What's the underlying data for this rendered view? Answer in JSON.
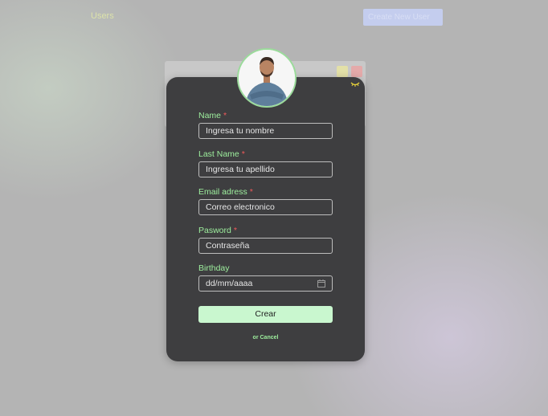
{
  "topbar": {
    "users_label": "Users",
    "create_label": "Create New User"
  },
  "form": {
    "required_mark": "*",
    "fields": [
      {
        "label": "Name",
        "required": true,
        "placeholder": "Ingresa tu nombre"
      },
      {
        "label": "Last Name",
        "required": true,
        "placeholder": "Ingresa tu apellido"
      },
      {
        "label": "Email adress",
        "required": true,
        "placeholder": "Correo electronico"
      },
      {
        "label": "Pasword",
        "required": true,
        "placeholder": "Contraseña"
      },
      {
        "label": "Birthday",
        "required": false,
        "value": "dd/mm/aaaa"
      }
    ],
    "submit_label": "Crear",
    "cancel_label": "or Cancel"
  },
  "icons": {
    "visibility": "eye-closed-icon",
    "calendar": "calendar-icon"
  },
  "colors": {
    "modal_bg": "#3e3e40",
    "label_green": "#9ef09e",
    "required_red": "#f05a5a",
    "button_bg": "#c9f7cf"
  }
}
